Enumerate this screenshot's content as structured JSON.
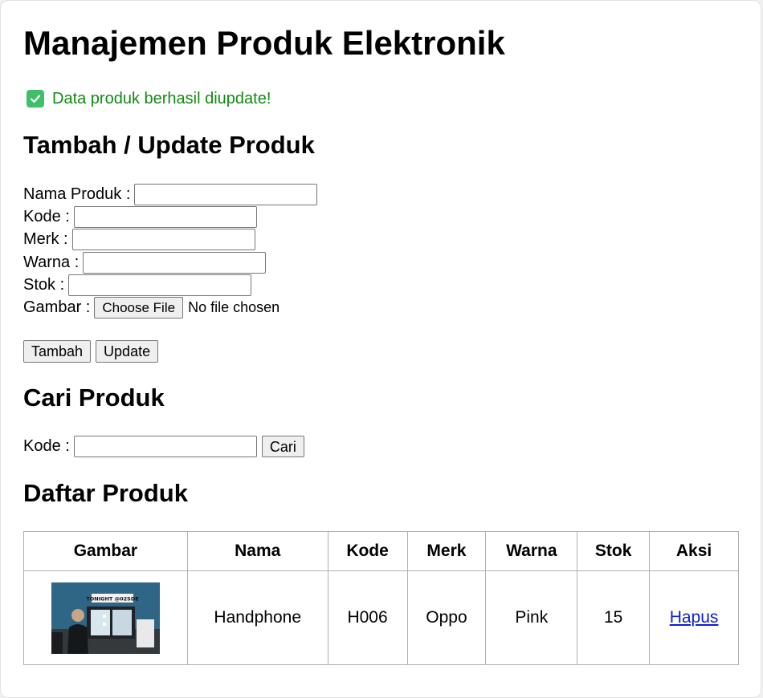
{
  "page": {
    "title": "Manajemen Produk Elektronik",
    "status_message": "Data produk berhasil diupdate!",
    "status_icon": "check-icon",
    "status_color": "#128a12"
  },
  "form": {
    "heading": "Tambah / Update Produk",
    "fields": {
      "nama_label": "Nama Produk :",
      "kode_label": "Kode :",
      "merk_label": "Merk :",
      "warna_label": "Warna :",
      "stok_label": "Stok :",
      "gambar_label": "Gambar :"
    },
    "file_button": "Choose File",
    "file_status": "No file chosen",
    "add_button": "Tambah",
    "update_button": "Update"
  },
  "search": {
    "heading": "Cari Produk",
    "label": "Kode :",
    "button": "Cari"
  },
  "list": {
    "heading": "Daftar Produk",
    "columns": [
      "Gambar",
      "Nama",
      "Kode",
      "Merk",
      "Warna",
      "Stok",
      "Aksi"
    ],
    "rows": [
      {
        "image_text": "TONIGHT @02SDE",
        "nama": "Handphone",
        "kode": "H006",
        "merk": "Oppo",
        "warna": "Pink",
        "stok": "15",
        "aksi": "Hapus"
      }
    ]
  }
}
